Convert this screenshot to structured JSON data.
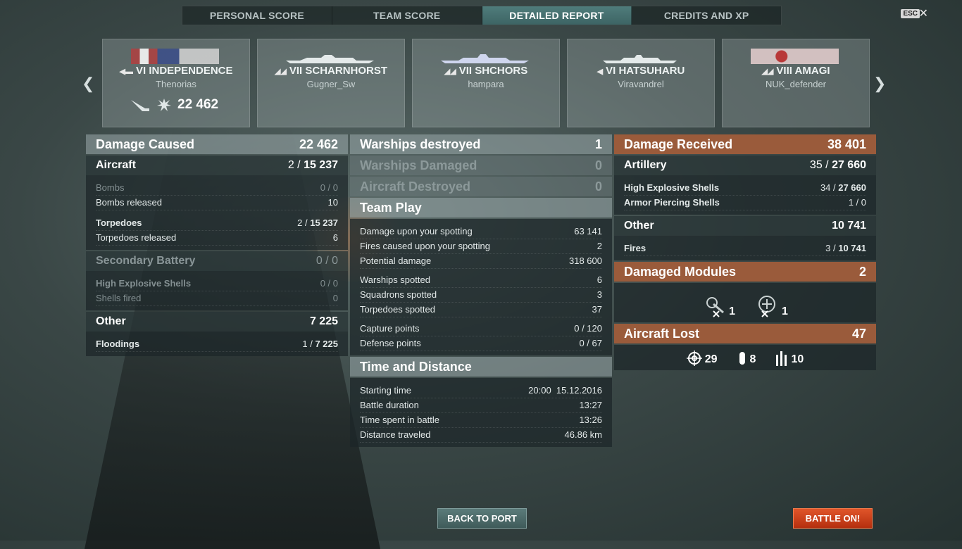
{
  "tabs": [
    "PERSONAL SCORE",
    "TEAM SCORE",
    "DETAILED REPORT",
    "CREDITS AND XP"
  ],
  "esc_label": "ESC",
  "ships": [
    {
      "tier": "VI",
      "name": "INDEPENDENCE",
      "player": "Thenorias",
      "damage": "22 462",
      "class": "carrier"
    },
    {
      "tier": "VII",
      "name": "SCHARNHORST",
      "player": "Gugner_Sw",
      "class": "battleship"
    },
    {
      "tier": "VII",
      "name": "SHCHORS",
      "player": "hampara",
      "class": "cruiser"
    },
    {
      "tier": "VI",
      "name": "HATSUHARU",
      "player": "Viravandrel",
      "class": "destroyer"
    },
    {
      "tier": "VIII",
      "name": "AMAGI",
      "player": "NUK_defender",
      "class": "battleship"
    }
  ],
  "left": {
    "damage_caused": {
      "label": "Damage Caused",
      "value": "22 462"
    },
    "aircraft": {
      "label": "Aircraft",
      "value_a": "2 / ",
      "value_b": "15 237"
    },
    "bombs": {
      "label": "Bombs",
      "value": "0 / 0"
    },
    "bombs_released": {
      "label": "Bombs released",
      "value": "10"
    },
    "torpedoes": {
      "label": "Torpedoes",
      "value_a": "2 / ",
      "value_b": "15 237"
    },
    "torpedoes_released": {
      "label": "Torpedoes released",
      "value": "6"
    },
    "secondary": {
      "label": "Secondary Battery",
      "value": "0 / 0"
    },
    "he_shells": {
      "label": "High Explosive Shells",
      "value": "0 / 0"
    },
    "shells_fired": {
      "label": "Shells fired",
      "value": "0"
    },
    "other": {
      "label": "Other",
      "value": "7 225"
    },
    "floodings": {
      "label": "Floodings",
      "value_a": "1 / ",
      "value_b": "7 225"
    }
  },
  "middle": {
    "warships_destroyed": {
      "label": "Warships destroyed",
      "value": "1"
    },
    "warships_damaged": {
      "label": "Warships Damaged",
      "value": "0"
    },
    "aircraft_destroyed": {
      "label": "Aircraft Destroyed",
      "value": "0"
    },
    "team_play": "Team Play",
    "tp1": [
      {
        "label": "Damage upon your spotting",
        "value": "63 141"
      },
      {
        "label": "Fires caused upon your spotting",
        "value": "2"
      },
      {
        "label": "Potential damage",
        "value": "318 600"
      }
    ],
    "tp2": [
      {
        "label": "Warships spotted",
        "value": "6"
      },
      {
        "label": "Squadrons spotted",
        "value": "3"
      },
      {
        "label": "Torpedoes spotted",
        "value": "37"
      }
    ],
    "tp3": [
      {
        "label": "Capture points",
        "value": "0 / 120"
      },
      {
        "label": "Defense points",
        "value": "0 / 67"
      }
    ],
    "time_distance": "Time and Distance",
    "td": [
      {
        "label": "Starting time",
        "value": "20:00  15.12.2016"
      },
      {
        "label": "Battle duration",
        "value": "13:27"
      },
      {
        "label": "Time spent in battle",
        "value": "13:26"
      },
      {
        "label": "Distance traveled",
        "value": "46.86 km"
      }
    ]
  },
  "right": {
    "damage_received": {
      "label": "Damage Received",
      "value": "38 401"
    },
    "artillery": {
      "label": "Artillery",
      "value_a": "35 / ",
      "value_b": "27 660"
    },
    "he_shells": {
      "label": "High Explosive Shells",
      "value_a": "34 / ",
      "value_b": "27 660"
    },
    "ap_shells": {
      "label": "Armor Piercing Shells",
      "value": "1 / 0"
    },
    "other": {
      "label": "Other",
      "value": "10 741"
    },
    "fires": {
      "label": "Fires",
      "value_a": "3 / ",
      "value_b": "10 741"
    },
    "damaged_modules": {
      "label": "Damaged Modules",
      "value": "2"
    },
    "modules": [
      {
        "icon": "gun-module-icon",
        "count": "1"
      },
      {
        "icon": "aa-module-icon",
        "count": "1"
      }
    ],
    "aircraft_lost": {
      "label": "Aircraft Lost",
      "value": "47"
    },
    "aircraft": [
      {
        "icon": "fighter-icon",
        "count": "29"
      },
      {
        "icon": "bomber-icon",
        "count": "8"
      },
      {
        "icon": "torpedo-bomber-icon",
        "count": "10"
      }
    ]
  },
  "buttons": {
    "back": "BACK TO PORT",
    "battle": "BATTLE ON!"
  }
}
